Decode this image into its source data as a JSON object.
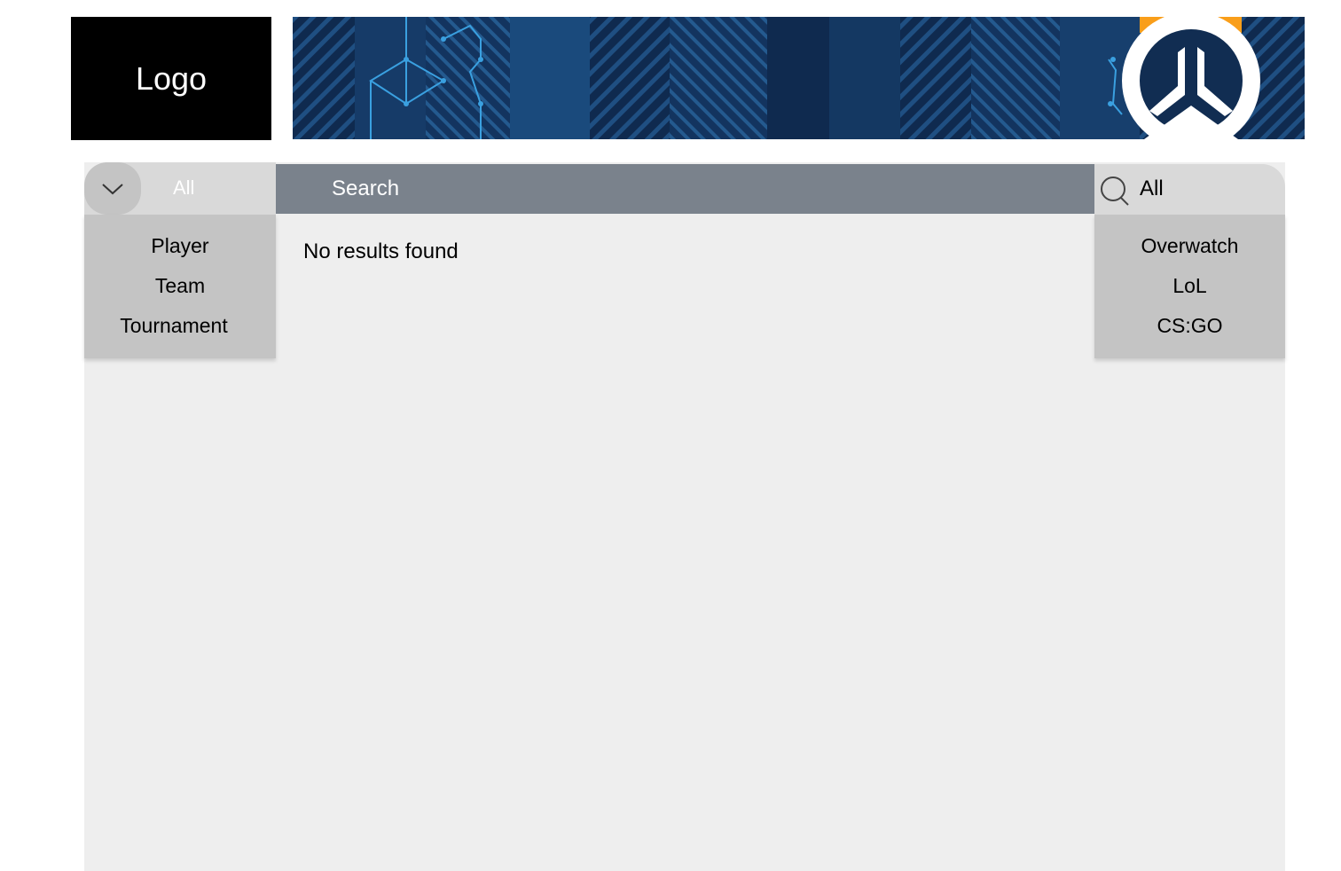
{
  "header": {
    "logo_text": "Logo",
    "banner_icon": "overwatch-emblem"
  },
  "filters": {
    "category": {
      "selected": "All",
      "toggle_icon": "chevron-down-icon",
      "options": [
        "Player",
        "Team",
        "Tournament"
      ]
    },
    "search": {
      "placeholder": "Search",
      "icon": "search-icon"
    },
    "game": {
      "selected": "All",
      "options": [
        "Overwatch",
        "LoL",
        "CS:GO"
      ]
    }
  },
  "results": {
    "empty_message": "No results found"
  },
  "colors": {
    "search_bar": "#7a828c",
    "dropdown_bg": "#c4c4c4",
    "select_bg": "#d9d9d9",
    "panel_bg": "#eeeeee",
    "banner_bg": "#0f2a4f",
    "emblem_accent": "#f99e1a"
  }
}
